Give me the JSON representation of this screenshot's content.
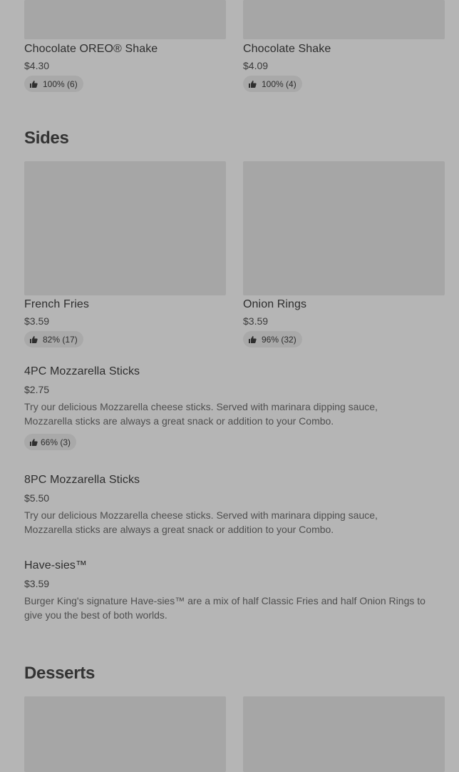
{
  "shakes": [
    {
      "name": "Chocolate OREO® Shake",
      "price": "$4.30",
      "rating": "100% (6)"
    },
    {
      "name": "Chocolate Shake",
      "price": "$4.09",
      "rating": "100% (4)"
    }
  ],
  "sides": {
    "title": "Sides",
    "cards": [
      {
        "name": "French Fries",
        "price": "$3.59",
        "rating": "82% (17)"
      },
      {
        "name": "Onion Rings",
        "price": "$3.59",
        "rating": "96% (32)"
      }
    ],
    "list": [
      {
        "name": "4PC Mozzarella Sticks",
        "price": "$2.75",
        "desc1": "Try our delicious Mozzarella cheese sticks. Served with marinara dipping sauce,",
        "desc2": "Mozzarella sticks are always a great snack or addition to your Combo.",
        "rating": "66% (3)"
      },
      {
        "name": "8PC Mozzarella Sticks",
        "price": "$5.50",
        "desc1": "Try our delicious Mozzarella cheese sticks. Served with marinara dipping sauce,",
        "desc2": "Mozzarella sticks are always a great snack or addition to your Combo."
      },
      {
        "name": "Have-sies™",
        "price": "$3.59",
        "desc1": "Burger King's signature Have-sies™ are a mix of half Classic Fries and half Onion Rings to",
        "desc2": "give you the best of both worlds."
      }
    ]
  },
  "desserts": {
    "title": "Desserts"
  },
  "icons": {
    "rating": "thumbs-up-icon"
  },
  "colors": {
    "background": "#b5b5b5",
    "image_placeholder": "#a6a6a6"
  }
}
